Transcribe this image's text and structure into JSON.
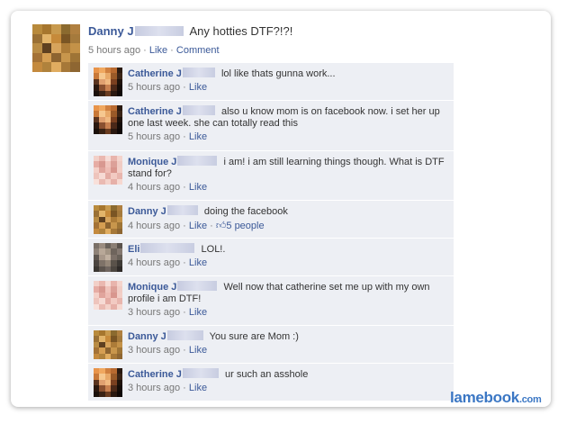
{
  "colors": {
    "link": "#3b5998",
    "comment_bg": "#edeff4",
    "watermark": "#3b77c4"
  },
  "post": {
    "author": "Danny J",
    "text": "Any hotties DTF?!?!",
    "time": "5 hours ago",
    "sep": "·",
    "like": "Like",
    "comment": "Comment"
  },
  "comments": [
    {
      "author": "Catherine J",
      "text": "lol like thats gunna work...",
      "time": "5 hours ago",
      "like": "Like"
    },
    {
      "author": "Catherine J",
      "text": "also u know mom is on facebook now. i set her up one last week. she can totally read this",
      "time": "5 hours ago",
      "like": "Like"
    },
    {
      "author": "Monique J",
      "text": "i am! i am still learning things though. What is DTF stand for?",
      "time": "4 hours ago",
      "like": "Like"
    },
    {
      "author": "Danny J",
      "text": "doing the facebook",
      "time": "4 hours ago",
      "like": "Like",
      "likes": "5 people"
    },
    {
      "author": "Eli",
      "text": "LOL!.",
      "time": "4 hours ago",
      "like": "Like"
    },
    {
      "author": "Monique J",
      "text": "Well now that catherine set me up with my own profile i am DTF!",
      "time": "3 hours ago",
      "like": "Like"
    },
    {
      "author": "Danny J",
      "text": "You sure are Mom :)",
      "time": "3 hours ago",
      "like": "Like"
    },
    {
      "author": "Catherine J",
      "text": "ur such an asshole",
      "time": "3 hours ago",
      "like": "Like"
    }
  ],
  "watermark": {
    "brand": "lamebook",
    "tld": ".com"
  }
}
